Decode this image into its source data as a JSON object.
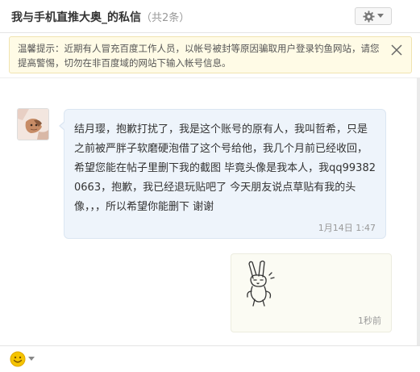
{
  "header": {
    "title": "我与手机直推大奥_的私信",
    "count": "（共2条）",
    "settings_icon": "gear-icon",
    "dropdown_icon": "caret-down-icon"
  },
  "notice": {
    "text": "温馨提示：近期有人冒充百度工作人员，以帐号被封等原因骗取用户登录钓鱼网站，请您提高警惕，切勿在非百度域的网站下输入帐号信息。",
    "close_icon": "close-icon"
  },
  "messages": [
    {
      "direction": "incoming",
      "text": "结月璎，抱歉打扰了，我是这个账号的原有人，我叫哲希，只是之前被严胖子软磨硬泡借了这个号给他，我几个月前已经收回，希望您能在帖子里删下我的截图 毕竟头像是我本人，我qq993820663，抱歉，我已经退玩贴吧了 今天朋友说点草贴有我的头像，，，所以希望你能删下 谢谢",
      "time": "1月14日 1:47"
    },
    {
      "direction": "outgoing",
      "content": "sticker",
      "time": "1秒前"
    }
  ],
  "footer": {
    "emoji_icon": "smiley-face-icon",
    "dropdown_icon": "caret-down-icon"
  },
  "colors": {
    "notice_bg": "#fffbe6",
    "incoming_bubble_bg": "#eef4fb",
    "outgoing_bubble_bg": "#fbfbf3",
    "emoji_yellow": "#f5c400"
  }
}
